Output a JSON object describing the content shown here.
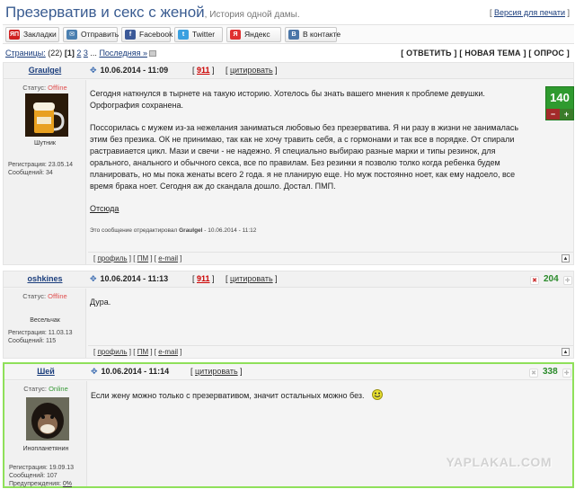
{
  "topic": {
    "title": "Презерватив и секс с женой",
    "subtitle": ", История одной дамы."
  },
  "print_version": {
    "label": "Версия для печати"
  },
  "share": [
    {
      "icon": "yandex-bookmarks-icon",
      "glyph": "ЯП",
      "label": "Закладки",
      "color": "#d02020"
    },
    {
      "icon": "send-icon",
      "glyph": "✉",
      "label": "Отправить",
      "color": "#4a7fb0"
    },
    {
      "icon": "facebook-icon",
      "glyph": "f",
      "label": "Facebook",
      "color": "#3b5998"
    },
    {
      "icon": "twitter-icon",
      "glyph": "t",
      "label": "Twitter",
      "color": "#3aa0e0"
    },
    {
      "icon": "yandex-icon",
      "glyph": "Я",
      "label": "Яндекс",
      "color": "#e03030"
    },
    {
      "icon": "vkontakte-icon",
      "glyph": "B",
      "label": "В контакте",
      "color": "#4a76a8"
    }
  ],
  "pagination": {
    "prefix": "Страницы:",
    "count": "(22)",
    "current": "1",
    "pages": [
      "2",
      "3"
    ],
    "ellipsis": "...",
    "last": "Последняя »"
  },
  "actions": [
    "[ ОТВЕТИТЬ ]",
    "[ НОВАЯ ТЕМА ]",
    "[ ОПРОС ]"
  ],
  "posts": [
    {
      "author": "GrauIgel",
      "date": "10.06.2014 - 11:09",
      "rep": "911",
      "quote": "цитировать",
      "status_label": "Статус:",
      "status": "Offline",
      "rank": "Шутник",
      "reg": "Регистрация: 23.05.14",
      "msgs": "Сообщений: 34",
      "p1": "Сегодня наткнулся в тырнете на такую историю. Хотелось бы знать вашего мнения к проблеме девушки. Орфография сохранена.",
      "p2": "Поссорилась с мужем из-за нежелания заниматься любовью без презерватива. Я ни разу в жизни не занималась этим без презика. ОК не принимаю, так как не хочу травить себя, а с гормонами и так все в порядке. От спирали растравиается цикл. Мази и свечи - не надежно. Я специально выбираю разные марки и типы резинок, для орального, анального и обычного секса, все по правилам. Без резинки я позволю толко когда ребенка будем планировать, но мы пока женаты всего 2 года. я не планирую еще. Но муж постоянно ноет, как ему надоело, все время брака ноет. Сегодня аж до скандала дошло. Достал. ПМП.",
      "source": "Отсюда",
      "edited_prefix": "Это сообщение отредактировал ",
      "edited_user": "GrauIgel",
      "edited_suffix": " - 10.06.2014 - 11:12",
      "score": "140",
      "minus": "−",
      "plus": "+"
    },
    {
      "author": "oshkines",
      "date": "10.06.2014 - 11:13",
      "rep": "911",
      "quote": "цитировать",
      "status_label": "Статус:",
      "status": "Offline",
      "rank": "Весельчак",
      "reg": "Регистрация: 11.03.13",
      "msgs": "Сообщений: 115",
      "text": "Дура.",
      "score": "204"
    },
    {
      "author": "Шей",
      "date": "10.06.2014 - 11:14",
      "quote": "цитировать",
      "status_label": "Статус:",
      "status": "Online",
      "rank": "Инопланетянин",
      "reg": "Регистрация: 19.09.13",
      "msgs": "Сообщений: 107",
      "warn_label": "Предупреждения:",
      "warn": "0%",
      "text": "Если жену можно только с презервативом, значит остальных можно без.",
      "score": "338"
    }
  ],
  "footer": {
    "profile": "профиль",
    "pm": "ПМ",
    "email": "e-mail"
  },
  "watermark": "YAPLAKAL.COM"
}
